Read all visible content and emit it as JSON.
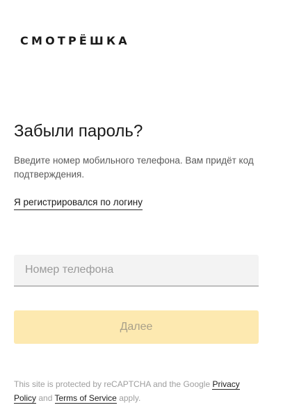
{
  "brand": {
    "logo_text": "СМОТРЁШКА"
  },
  "page": {
    "title": "Забыли пароль?",
    "description": "Введите номер мобильного телефона. Вам придёт код подтверждения.",
    "login_link": "Я регистрировался по логину"
  },
  "form": {
    "phone_placeholder": "Номер телефона",
    "phone_value": "",
    "submit_label": "Далее",
    "submit_bg_color": "#fde9b0"
  },
  "recaptcha": {
    "text_before": "This site is protected by reCAPTCHA and the Google ",
    "privacy_label": "Privacy Policy",
    "text_and": " and ",
    "terms_label": "Terms of Service",
    "text_after": " apply."
  }
}
